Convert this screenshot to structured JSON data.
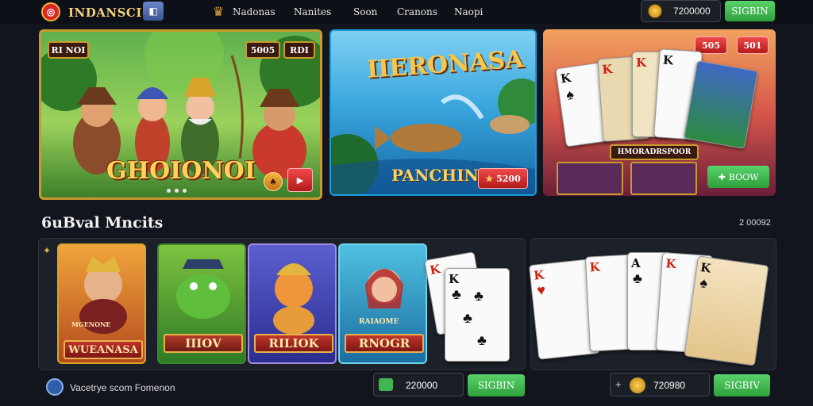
{
  "header": {
    "logo_text": "INDANSCI",
    "nav": [
      "Nadonas",
      "Nanites",
      "Soon",
      "Cranons",
      "Naopi"
    ],
    "balance": "7200000",
    "signin_label": "SIGBIN"
  },
  "banners": {
    "left": {
      "tag": "RI NOI",
      "btn1": "5005",
      "btn2": "RDI",
      "title": "GHOIONOI"
    },
    "middle": {
      "title": "IIERONASA",
      "subtitle": "PANCHING",
      "button": "5200"
    },
    "right": {
      "btn1": "505",
      "btn2": "501",
      "label": "HMORADRSPOOR",
      "button": "BOOW"
    }
  },
  "section": {
    "title": "6uBval Mncits",
    "count": "2 00092"
  },
  "games": [
    {
      "name": "WUEANASA",
      "sub": "MGENONE"
    },
    {
      "name": "IIIOV"
    },
    {
      "name": "RILIOK"
    },
    {
      "name": "RNOGR",
      "sub": "RAIAOME"
    }
  ],
  "footer": {
    "left_text": "Vacetrye scom Fomenon",
    "left_balance": "220000",
    "left_button": "SIGBIN",
    "right_balance": "720980",
    "right_button": "SIGBIV"
  },
  "colors": {
    "accent_green": "#3fb64f",
    "gold": "#c99a2e",
    "background": "#12151d"
  }
}
